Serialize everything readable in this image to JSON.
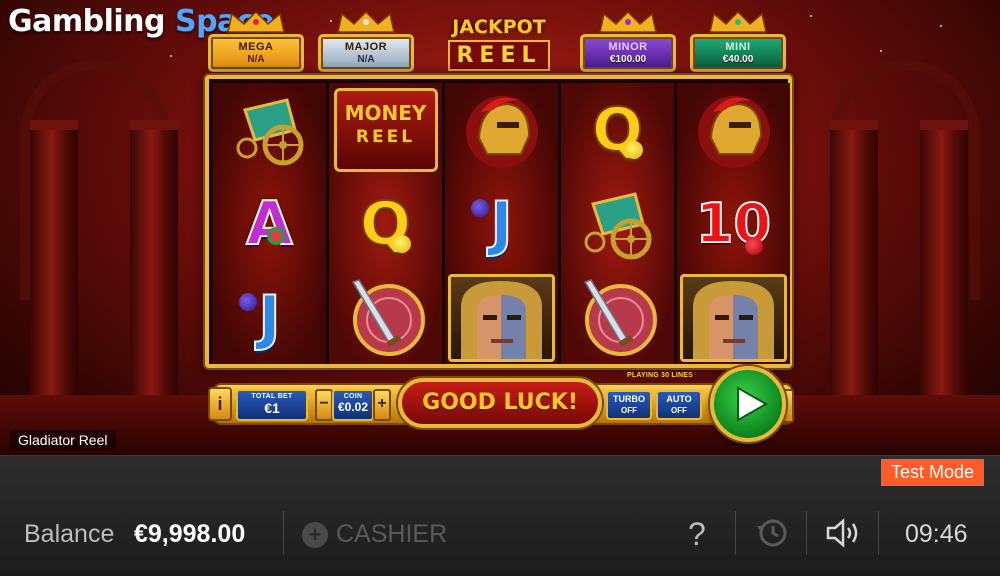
{
  "brand": {
    "word1": "Gambling",
    "word2": "Space"
  },
  "jackpots": {
    "title_line1": "JACKPOT",
    "title_line2": "REEL",
    "mega": {
      "name": "MEGA",
      "value": "N/A"
    },
    "major": {
      "name": "MAJOR",
      "value": "N/A"
    },
    "minor": {
      "name": "MINOR",
      "value": "€100.00"
    },
    "mini": {
      "name": "MINI",
      "value": "€40.00"
    }
  },
  "reels": [
    [
      "chariot",
      "A",
      "J"
    ],
    [
      "money-reel",
      "Q",
      "shield-sword"
    ],
    [
      "helmet",
      "J",
      "gladiator"
    ],
    [
      "Q",
      "chariot",
      "shield-sword"
    ],
    [
      "helmet",
      "10",
      "gladiator"
    ]
  ],
  "money_reel": {
    "line1": "MONEY",
    "line2": "REEL"
  },
  "controls": {
    "info_label": "i",
    "total_bet_label": "TOTAL BET",
    "total_bet_value": "€1",
    "coin_label": "COIN",
    "coin_value": "€0.02",
    "minus_label": "−",
    "plus_label": "+",
    "message": "GOOD LUCK!",
    "lines_label": "PLAYING 30 LINES",
    "turbo_label": "TURBO",
    "turbo_state": "OFF",
    "auto_label": "AUTO",
    "auto_state": "OFF"
  },
  "game_name": "Gladiator Reel",
  "casino_bar": {
    "test_mode": "Test Mode",
    "balance_label": "Balance",
    "balance_value": "€9,998.00",
    "cashier_label": "CASHIER",
    "help_label": "?",
    "time": "09:46"
  },
  "colors": {
    "gold": "#e8b93a",
    "spin_green": "#16a82a",
    "test_mode": "#ff5a2a",
    "logo_blue": "#4ea6ff"
  }
}
